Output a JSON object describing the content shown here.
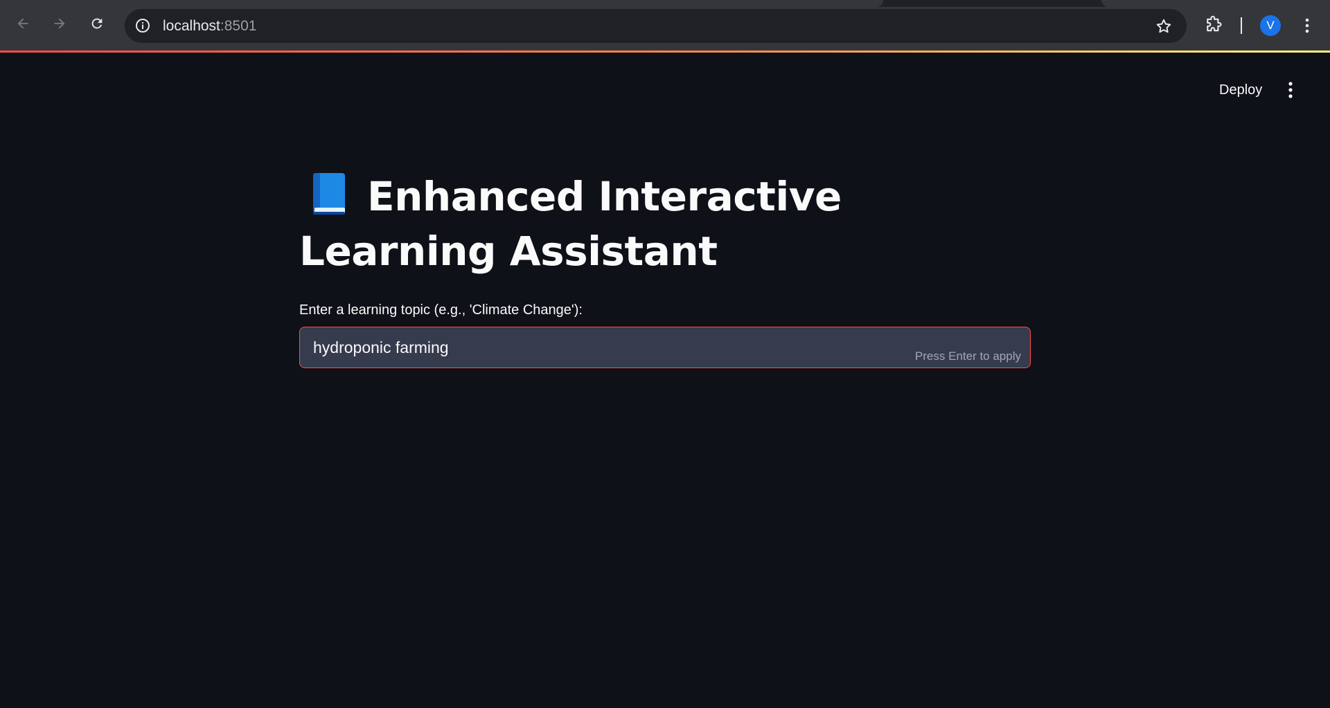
{
  "browser": {
    "url_host": "localhost",
    "url_port": ":8501",
    "profile_initial": "V"
  },
  "toolbar": {
    "deploy_label": "Deploy"
  },
  "main": {
    "title_line": "Enhanced Interactive Learning Assistant",
    "title_emoji": "book-icon",
    "input_label": "Enter a learning topic (e.g., 'Climate Change'):",
    "input_value": "hydroponic farming",
    "input_hint": "Press Enter to apply"
  },
  "colors": {
    "background": "#0e1117",
    "accent": "#ff4b4b",
    "input_bg": "#363b4d",
    "avatar": "#1a73e8"
  }
}
